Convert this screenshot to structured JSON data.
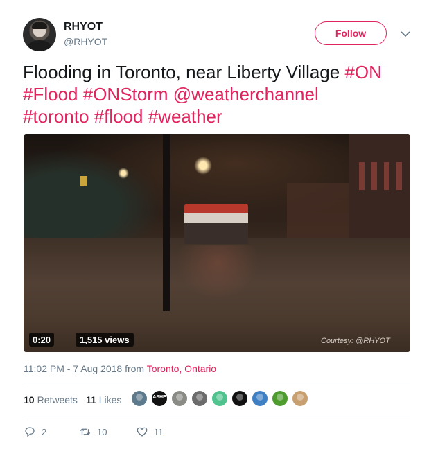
{
  "user": {
    "name": "RHYOT",
    "handle": "@RHYOT",
    "avatar_icon": "user-avatar"
  },
  "follow_button": {
    "label": "Follow"
  },
  "tweet": {
    "text_plain": "Flooding in Toronto, near Liberty Village ",
    "tags": [
      "#ON",
      "#Flood",
      "#ONStorm",
      "@weatherchannel",
      "#toronto",
      "#flood",
      "#weather"
    ]
  },
  "media": {
    "duration": "0:20",
    "views": "1,515 views",
    "watermark": "Courtesy: @RHYOT"
  },
  "meta": {
    "time": "11:02 PM - 7 Aug 2018 from ",
    "location": "Toronto, Ontario"
  },
  "stats": {
    "retweets_count": "10",
    "retweets_label": "Retweets",
    "likes_count": "11",
    "likes_label": "Likes"
  },
  "likers": [
    {
      "icon": "liker-avatar",
      "color": "#5d7a8c"
    },
    {
      "icon": "liker-avatar",
      "color": "#111111",
      "text": "ASHE"
    },
    {
      "icon": "liker-avatar",
      "color": "#8b8b85"
    },
    {
      "icon": "liker-avatar",
      "color": "#6c6c6c"
    },
    {
      "icon": "liker-avatar",
      "color": "#4fc28e"
    },
    {
      "icon": "liker-avatar",
      "color": "#111111"
    },
    {
      "icon": "liker-avatar",
      "color": "#3f7fc4"
    },
    {
      "icon": "liker-avatar",
      "color": "#4e9b2e"
    },
    {
      "icon": "liker-avatar",
      "color": "#c8a070"
    }
  ],
  "actions": {
    "replies": "2",
    "retweets": "10",
    "likes": "11"
  },
  "colors": {
    "accent": "#e0245e",
    "muted": "#657786",
    "text": "#14171a"
  }
}
